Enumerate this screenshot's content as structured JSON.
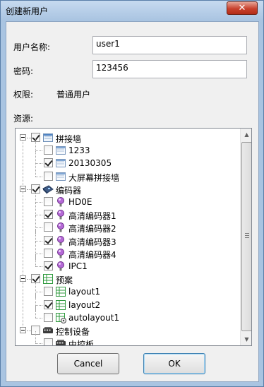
{
  "window": {
    "title": "创建新用户",
    "close_glyph": "✕"
  },
  "form": {
    "username_label": "用户名称:",
    "username_value": "user1",
    "password_label": "密码:",
    "password_value": "123456",
    "permission_label": "权限:",
    "permission_value": "普通用户",
    "resources_label": "资源:"
  },
  "tree": [
    {
      "label": "拼接墙",
      "level": 0,
      "checked": true,
      "icon": "display-wall-icon",
      "expanded": true
    },
    {
      "label": "1233",
      "level": 1,
      "checked": false,
      "icon": "wall-layout-icon"
    },
    {
      "label": "20130305",
      "level": 1,
      "checked": true,
      "icon": "wall-layout-icon"
    },
    {
      "label": "大屏幕拼接墙",
      "level": 1,
      "checked": false,
      "icon": "wall-layout-icon"
    },
    {
      "label": "编码器",
      "level": 0,
      "checked": true,
      "icon": "encoder-icon",
      "expanded": true
    },
    {
      "label": "HD0E",
      "level": 1,
      "checked": false,
      "icon": "bulb-icon"
    },
    {
      "label": "高清编码器1",
      "level": 1,
      "checked": true,
      "icon": "bulb-icon"
    },
    {
      "label": "高清编码器2",
      "level": 1,
      "checked": false,
      "icon": "bulb-icon"
    },
    {
      "label": "高清编码器3",
      "level": 1,
      "checked": true,
      "icon": "bulb-icon"
    },
    {
      "label": "高清编码器4",
      "level": 1,
      "checked": false,
      "icon": "bulb-icon"
    },
    {
      "label": "IPC1",
      "level": 1,
      "checked": true,
      "icon": "bulb-icon"
    },
    {
      "label": "预案",
      "level": 0,
      "checked": true,
      "icon": "grid-layout-icon",
      "expanded": true
    },
    {
      "label": "layout1",
      "level": 1,
      "checked": false,
      "icon": "grid-layout-icon"
    },
    {
      "label": "layout2",
      "level": 1,
      "checked": true,
      "icon": "grid-layout-icon"
    },
    {
      "label": "autolayout1",
      "level": 1,
      "checked": false,
      "icon": "auto-layout-icon"
    },
    {
      "label": "控制设备",
      "level": 0,
      "checked": false,
      "icon": "control-device-icon",
      "expanded": true
    },
    {
      "label": "中控板",
      "level": 1,
      "checked": false,
      "icon": "control-device-icon"
    }
  ],
  "buttons": {
    "cancel": "Cancel",
    "ok": "OK"
  },
  "colors": {
    "titlebar": "#a9c4e1",
    "close_button": "#c8412d",
    "dialog_bg": "#f0f0f0"
  }
}
